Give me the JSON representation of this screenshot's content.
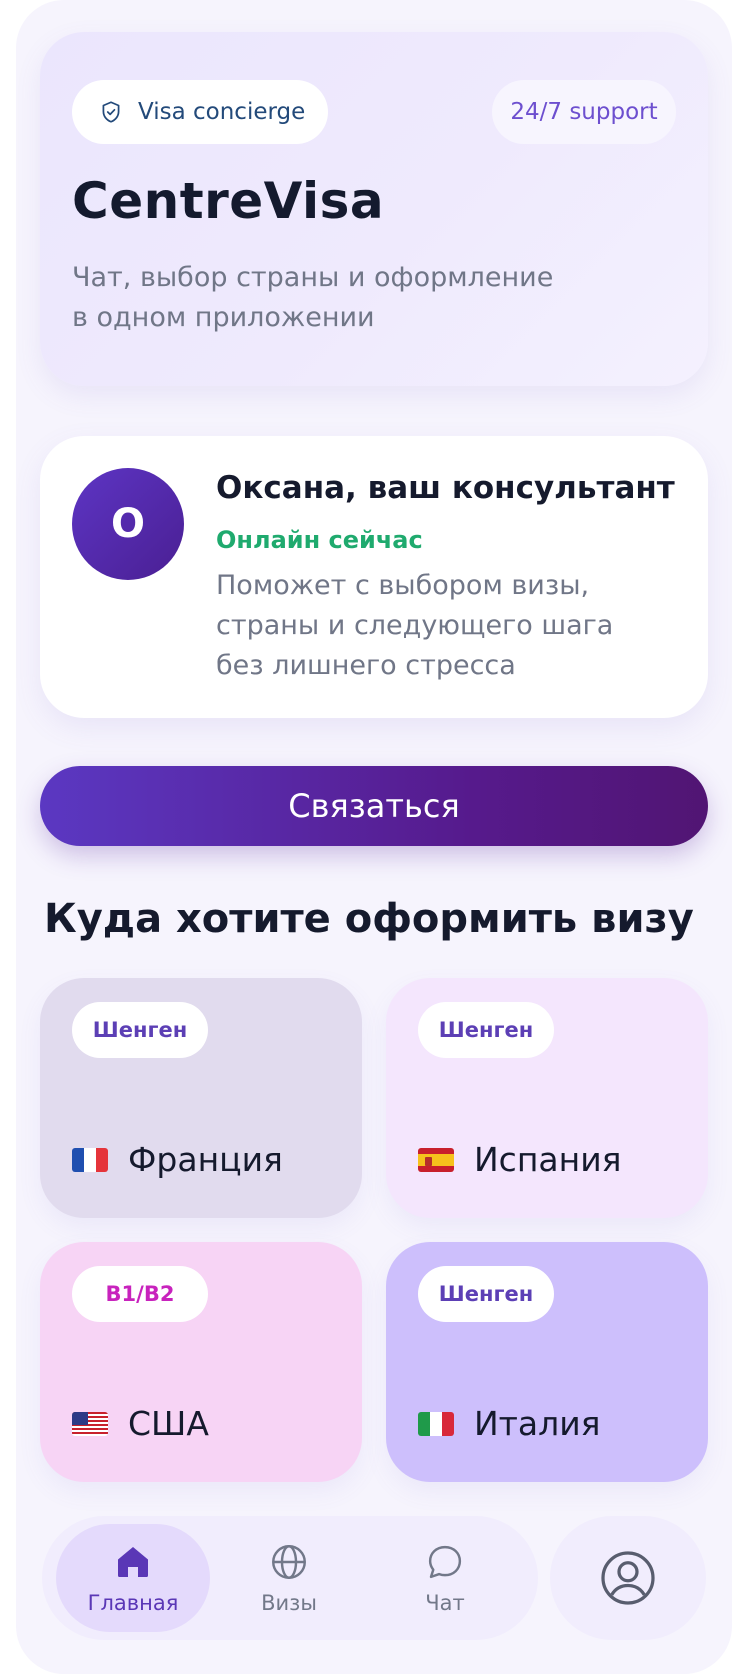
{
  "hero": {
    "concierge_label": "Visa concierge",
    "support_label": "24/7 support",
    "title": "CentreVisa",
    "subtitle_line1": "Чат, выбор страны и оформление",
    "subtitle_line2": "в одном приложении"
  },
  "consultant": {
    "initial": "О",
    "name": "Оксана, ваш консультант",
    "status": "Онлайн сейчас",
    "desc_line1": "Поможет с выбором визы,",
    "desc_line2": "страны и следующего шага",
    "desc_line3": "без лишнего стресса"
  },
  "cta": {
    "label": "Связаться"
  },
  "destinations": {
    "title": "Куда хотите оформить визу",
    "cards": [
      {
        "tag": "Шенген",
        "country": "Франция",
        "flag_icon": "france-flag-icon",
        "bg": "#e1dbee"
      },
      {
        "tag": "Шенген",
        "country": "Испания",
        "flag_icon": "spain-flag-icon",
        "bg": "#f4e6fd"
      },
      {
        "tag": "B1/B2",
        "country": "США",
        "flag_icon": "usa-flag-icon",
        "bg": "#f7d4f5"
      },
      {
        "tag": "Шенген",
        "country": "Италия",
        "flag_icon": "italy-flag-icon",
        "bg": "#cdbffc"
      }
    ]
  },
  "tabbar": {
    "items": [
      {
        "label": "Главная",
        "icon": "home-icon",
        "active": true
      },
      {
        "label": "Визы",
        "icon": "globe-icon",
        "active": false
      },
      {
        "label": "Чат",
        "icon": "chat-bubble-icon",
        "active": false
      }
    ],
    "profile_icon": "profile-icon"
  },
  "colors": {
    "accent": "#5b38c2",
    "accent_dark": "#511573",
    "online": "#1faa6e",
    "text": "#151a2d",
    "muted": "#707687"
  }
}
